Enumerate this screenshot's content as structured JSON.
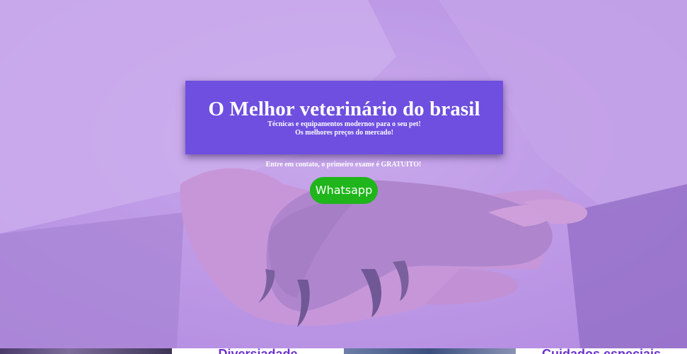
{
  "hero": {
    "title": "O Melhor veterinário do brasil",
    "subtitle_line1": "Técnicas e equipamentos modernos para o seu pet!",
    "subtitle_line2": "Os melhores preços do mercado!",
    "cta_text": "Entre em contato, o primeiro exame é GRATUITO!",
    "whatsapp_label": "Whatsapp"
  },
  "cards": {
    "card1_heading": "Diversiadade",
    "card2_heading": "Cuidados especiais"
  },
  "colors": {
    "title_box": "#6e4fe0",
    "whatsapp": "#1fb51b",
    "overlay": "#cfb0ee",
    "card_heading": "#6a2fd0"
  }
}
